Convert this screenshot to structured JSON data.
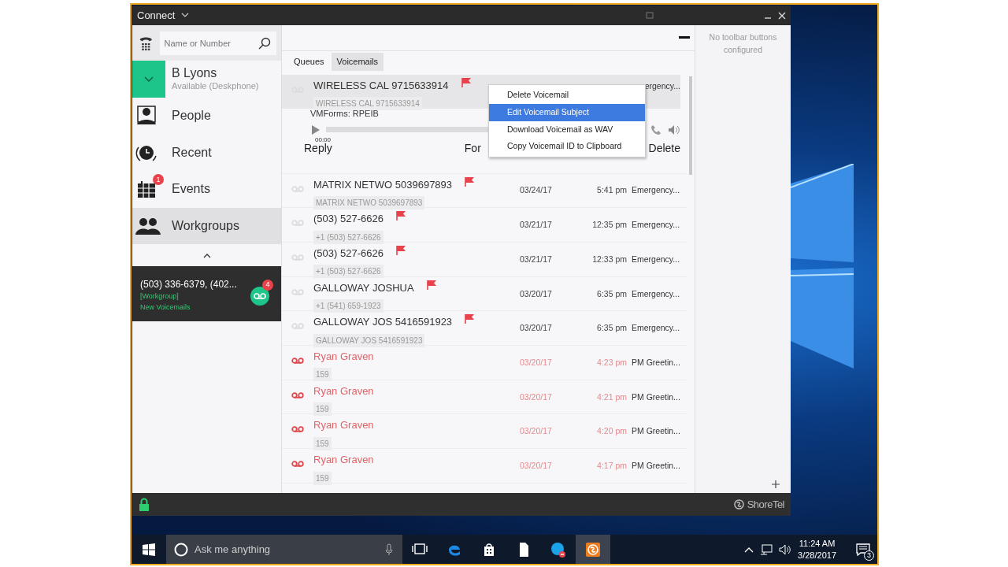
{
  "window": {
    "title": "Connect"
  },
  "search": {
    "placeholder": "Name or Number"
  },
  "user": {
    "name": "B Lyons",
    "status": "Available (Deskphone)"
  },
  "nav": [
    {
      "kind": "people",
      "label": "People",
      "selected": false
    },
    {
      "kind": "recent",
      "label": "Recent",
      "selected": false
    },
    {
      "kind": "events",
      "label": "Events",
      "badge": "1",
      "selected": false
    },
    {
      "kind": "workgroups",
      "label": "Workgroups",
      "selected": true
    }
  ],
  "notification": {
    "title": "(503) 336-6379, (402...",
    "tag": "[Workgroup]",
    "text": "New Voicemails",
    "badge": "4"
  },
  "tabs": [
    {
      "label": "Queues",
      "selected": false
    },
    {
      "label": "Voicemails",
      "selected": true
    }
  ],
  "voicemails": [
    {
      "name": "WIRELESS CAL 9715633914",
      "caller": "WIRELESS CAL 9715633914",
      "flagged": true,
      "unread": false,
      "selected": true,
      "expanded": true,
      "subject": "ergency...",
      "form": "VMForms: RPEIB",
      "player": {
        "level": 0,
        "elapsed": "00:00"
      },
      "actions": [
        "Reply",
        "For",
        "Delete"
      ]
    },
    {
      "name": "MATRIX NETWO 5039697893",
      "caller": "MATRIX NETWO 5039697893",
      "flagged": true,
      "unread": false,
      "selected": false,
      "expanded": false,
      "date": "03/24/17",
      "time": "5:41 pm",
      "subject": "Emergency..."
    },
    {
      "name": "(503) 527-6626",
      "caller": "+1 (503) 527-6626",
      "flagged": true,
      "unread": false,
      "selected": false,
      "expanded": false,
      "date": "03/21/17",
      "time": "12:35 pm",
      "subject": "Emergency..."
    },
    {
      "name": "(503) 527-6626",
      "caller": "+1 (503) 527-6626",
      "flagged": true,
      "unread": false,
      "selected": false,
      "expanded": false,
      "date": "03/21/17",
      "time": "12:33 pm",
      "subject": "Emergency..."
    },
    {
      "name": "GALLOWAY JOSHUA",
      "caller": "+1 (541) 659-1923",
      "flagged": true,
      "unread": false,
      "selected": false,
      "expanded": false,
      "date": "03/20/17",
      "time": "6:35 pm",
      "subject": "Emergency..."
    },
    {
      "name": "GALLOWAY JOS 5416591923",
      "caller": "GALLOWAY JOS 5416591923",
      "flagged": true,
      "unread": false,
      "selected": false,
      "expanded": false,
      "date": "03/20/17",
      "time": "6:35 pm",
      "subject": "Emergency..."
    },
    {
      "name": "Ryan Graven",
      "caller": "159",
      "flagged": false,
      "unread": true,
      "selected": false,
      "expanded": false,
      "date": "03/20/17",
      "time": "4:23 pm",
      "subject": "PM Greetin..."
    },
    {
      "name": "Ryan Graven",
      "caller": "159",
      "flagged": false,
      "unread": true,
      "selected": false,
      "expanded": false,
      "date": "03/20/17",
      "time": "4:21 pm",
      "subject": "PM Greetin..."
    },
    {
      "name": "Ryan Graven",
      "caller": "159",
      "flagged": false,
      "unread": true,
      "selected": false,
      "expanded": false,
      "date": "03/20/17",
      "time": "4:20 pm",
      "subject": "PM Greetin..."
    },
    {
      "name": "Ryan Graven",
      "caller": "159",
      "flagged": false,
      "unread": true,
      "selected": false,
      "expanded": false,
      "date": "03/20/17",
      "time": "4:17 pm",
      "subject": "PM Greetin..."
    }
  ],
  "context_menu": {
    "items": [
      {
        "label": "Delete Voicemail",
        "selected": false
      },
      {
        "label": "Edit Voicemail Subject",
        "selected": true
      },
      {
        "label": "Download Voicemail as WAV",
        "selected": false
      },
      {
        "label": "Copy Voicemail ID to Clipboard",
        "selected": false
      }
    ]
  },
  "toolbar_panel": {
    "message": "No toolbar buttons configured"
  },
  "status_bar": {
    "brand": "ShoreTel"
  },
  "taskbar": {
    "search_placeholder": "Ask me anything",
    "apps": [
      {
        "kind": "taskview",
        "active": false
      },
      {
        "kind": "browser",
        "active": false
      },
      {
        "kind": "store",
        "active": false
      },
      {
        "kind": "file",
        "active": false
      },
      {
        "kind": "chat",
        "active": false
      },
      {
        "kind": "shoretel",
        "active": true
      }
    ],
    "time": "11:24 AM",
    "date": "3/28/2017",
    "notifications": "3"
  }
}
